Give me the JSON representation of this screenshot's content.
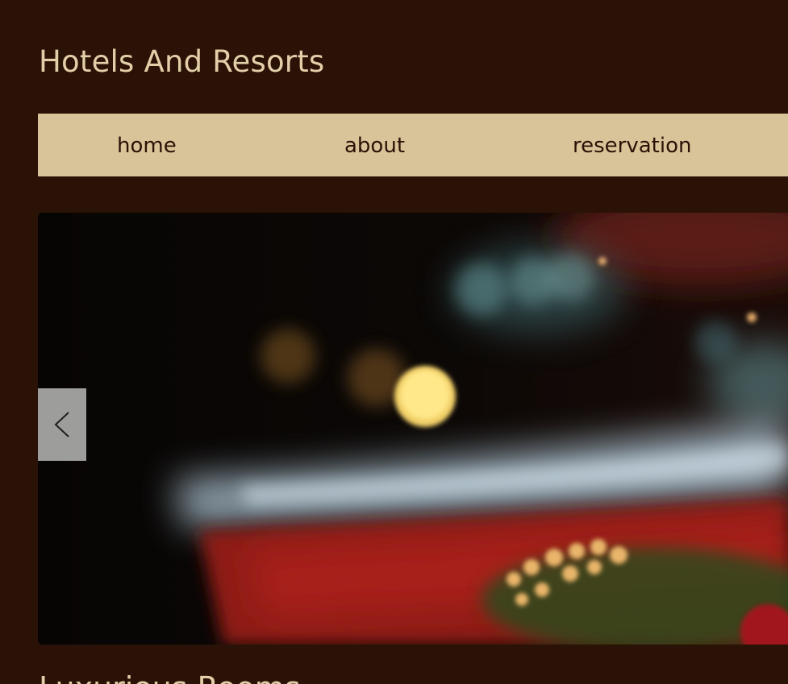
{
  "site": {
    "title": "Hotels And Resorts"
  },
  "nav": {
    "items": [
      {
        "label": "home"
      },
      {
        "label": "about"
      },
      {
        "label": "reservation"
      }
    ]
  },
  "slider": {
    "prev_icon": "chevron-left-icon"
  },
  "section": {
    "heading": "Luxurious Rooms"
  },
  "colors": {
    "background": "#2a1206",
    "nav_background": "#d9c49a",
    "title_text": "#e2cfa9",
    "nav_text": "#2a1206"
  }
}
